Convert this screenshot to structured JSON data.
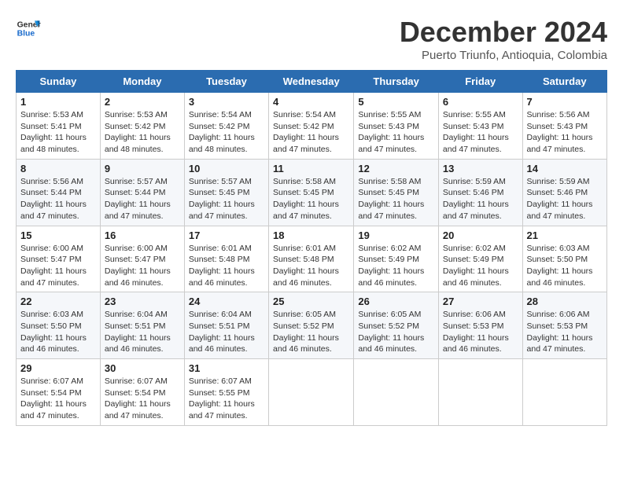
{
  "logo": {
    "line1": "General",
    "line2": "Blue"
  },
  "title": "December 2024",
  "subtitle": "Puerto Triunfo, Antioquia, Colombia",
  "header": {
    "days": [
      "Sunday",
      "Monday",
      "Tuesday",
      "Wednesday",
      "Thursday",
      "Friday",
      "Saturday"
    ]
  },
  "weeks": [
    [
      {
        "num": "1",
        "sunrise": "5:53 AM",
        "sunset": "5:41 PM",
        "daylight": "11 hours and 48 minutes."
      },
      {
        "num": "2",
        "sunrise": "5:53 AM",
        "sunset": "5:42 PM",
        "daylight": "11 hours and 48 minutes."
      },
      {
        "num": "3",
        "sunrise": "5:54 AM",
        "sunset": "5:42 PM",
        "daylight": "11 hours and 48 minutes."
      },
      {
        "num": "4",
        "sunrise": "5:54 AM",
        "sunset": "5:42 PM",
        "daylight": "11 hours and 47 minutes."
      },
      {
        "num": "5",
        "sunrise": "5:55 AM",
        "sunset": "5:43 PM",
        "daylight": "11 hours and 47 minutes."
      },
      {
        "num": "6",
        "sunrise": "5:55 AM",
        "sunset": "5:43 PM",
        "daylight": "11 hours and 47 minutes."
      },
      {
        "num": "7",
        "sunrise": "5:56 AM",
        "sunset": "5:43 PM",
        "daylight": "11 hours and 47 minutes."
      }
    ],
    [
      {
        "num": "8",
        "sunrise": "5:56 AM",
        "sunset": "5:44 PM",
        "daylight": "11 hours and 47 minutes."
      },
      {
        "num": "9",
        "sunrise": "5:57 AM",
        "sunset": "5:44 PM",
        "daylight": "11 hours and 47 minutes."
      },
      {
        "num": "10",
        "sunrise": "5:57 AM",
        "sunset": "5:45 PM",
        "daylight": "11 hours and 47 minutes."
      },
      {
        "num": "11",
        "sunrise": "5:58 AM",
        "sunset": "5:45 PM",
        "daylight": "11 hours and 47 minutes."
      },
      {
        "num": "12",
        "sunrise": "5:58 AM",
        "sunset": "5:45 PM",
        "daylight": "11 hours and 47 minutes."
      },
      {
        "num": "13",
        "sunrise": "5:59 AM",
        "sunset": "5:46 PM",
        "daylight": "11 hours and 47 minutes."
      },
      {
        "num": "14",
        "sunrise": "5:59 AM",
        "sunset": "5:46 PM",
        "daylight": "11 hours and 47 minutes."
      }
    ],
    [
      {
        "num": "15",
        "sunrise": "6:00 AM",
        "sunset": "5:47 PM",
        "daylight": "11 hours and 47 minutes."
      },
      {
        "num": "16",
        "sunrise": "6:00 AM",
        "sunset": "5:47 PM",
        "daylight": "11 hours and 46 minutes."
      },
      {
        "num": "17",
        "sunrise": "6:01 AM",
        "sunset": "5:48 PM",
        "daylight": "11 hours and 46 minutes."
      },
      {
        "num": "18",
        "sunrise": "6:01 AM",
        "sunset": "5:48 PM",
        "daylight": "11 hours and 46 minutes."
      },
      {
        "num": "19",
        "sunrise": "6:02 AM",
        "sunset": "5:49 PM",
        "daylight": "11 hours and 46 minutes."
      },
      {
        "num": "20",
        "sunrise": "6:02 AM",
        "sunset": "5:49 PM",
        "daylight": "11 hours and 46 minutes."
      },
      {
        "num": "21",
        "sunrise": "6:03 AM",
        "sunset": "5:50 PM",
        "daylight": "11 hours and 46 minutes."
      }
    ],
    [
      {
        "num": "22",
        "sunrise": "6:03 AM",
        "sunset": "5:50 PM",
        "daylight": "11 hours and 46 minutes."
      },
      {
        "num": "23",
        "sunrise": "6:04 AM",
        "sunset": "5:51 PM",
        "daylight": "11 hours and 46 minutes."
      },
      {
        "num": "24",
        "sunrise": "6:04 AM",
        "sunset": "5:51 PM",
        "daylight": "11 hours and 46 minutes."
      },
      {
        "num": "25",
        "sunrise": "6:05 AM",
        "sunset": "5:52 PM",
        "daylight": "11 hours and 46 minutes."
      },
      {
        "num": "26",
        "sunrise": "6:05 AM",
        "sunset": "5:52 PM",
        "daylight": "11 hours and 46 minutes."
      },
      {
        "num": "27",
        "sunrise": "6:06 AM",
        "sunset": "5:53 PM",
        "daylight": "11 hours and 46 minutes."
      },
      {
        "num": "28",
        "sunrise": "6:06 AM",
        "sunset": "5:53 PM",
        "daylight": "11 hours and 47 minutes."
      }
    ],
    [
      {
        "num": "29",
        "sunrise": "6:07 AM",
        "sunset": "5:54 PM",
        "daylight": "11 hours and 47 minutes."
      },
      {
        "num": "30",
        "sunrise": "6:07 AM",
        "sunset": "5:54 PM",
        "daylight": "11 hours and 47 minutes."
      },
      {
        "num": "31",
        "sunrise": "6:07 AM",
        "sunset": "5:55 PM",
        "daylight": "11 hours and 47 minutes."
      },
      null,
      null,
      null,
      null
    ]
  ]
}
